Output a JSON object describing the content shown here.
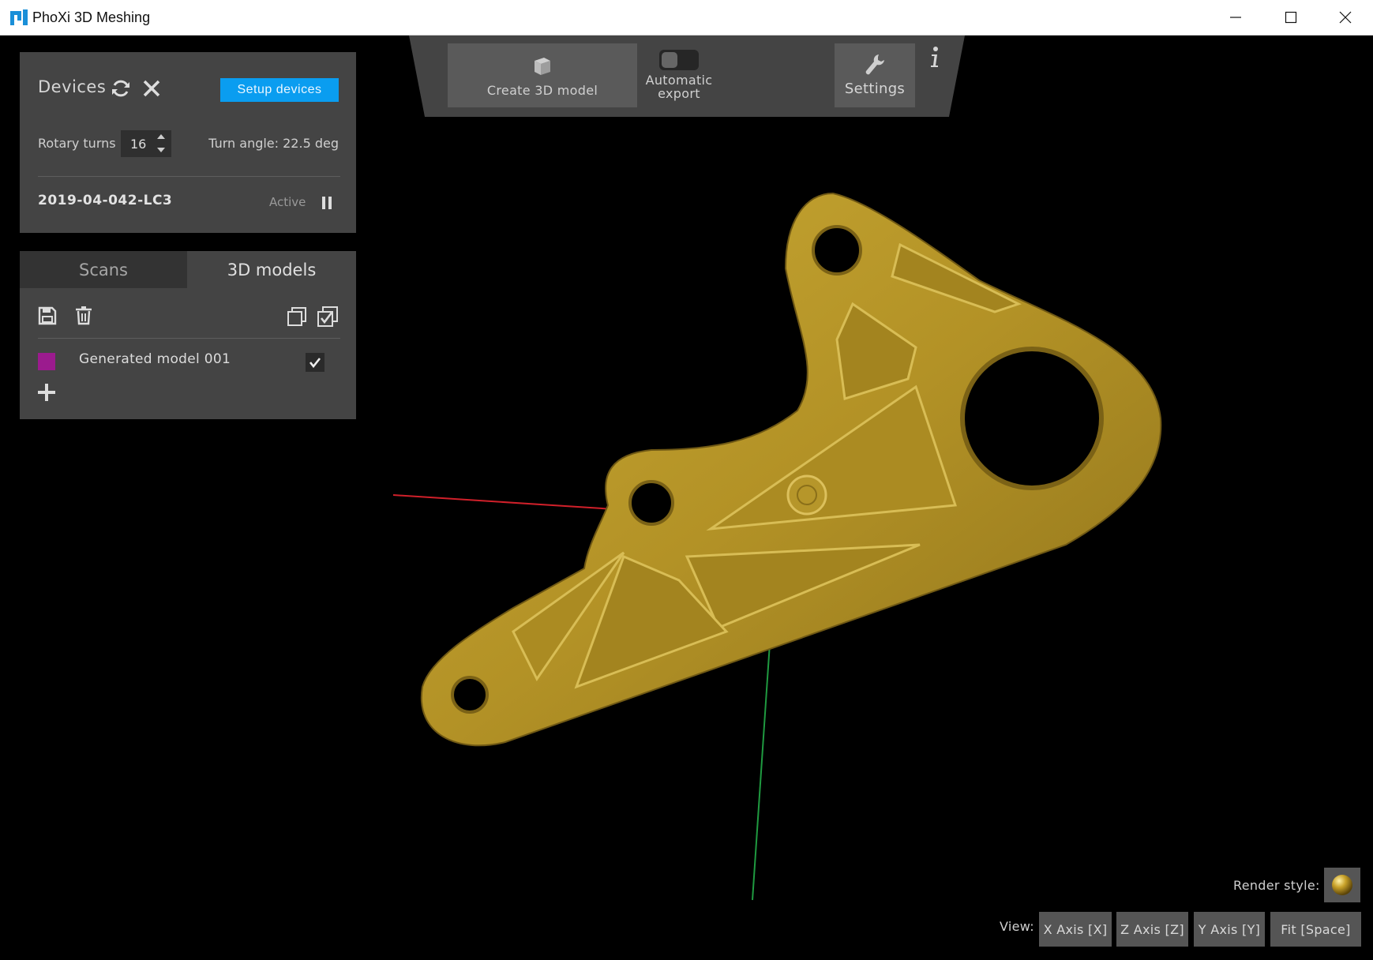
{
  "window": {
    "title": "PhoXi 3D Meshing",
    "logo_color": "#1a8fd8"
  },
  "devices": {
    "title": "Devices",
    "setup_button": "Setup devices",
    "rotary_label": "Rotary turns",
    "rotary_value": "16",
    "turn_angle": "Turn angle: 22.5 deg",
    "device_name": "2019-04-042-LC3",
    "device_status": "Active"
  },
  "models_panel": {
    "tabs": [
      {
        "label": "Scans",
        "active": false
      },
      {
        "label": "3D models",
        "active": true
      }
    ],
    "models": [
      {
        "name": "Generated model 001",
        "color": "#9b1b8e",
        "visible": true
      }
    ]
  },
  "toolbar": {
    "create_label": "Create 3D model",
    "auto_export_line1": "Automatic",
    "auto_export_line2": "export",
    "auto_export_on": false,
    "settings_label": "Settings"
  },
  "bottom": {
    "render_label": "Render style:",
    "view_label": "View:",
    "view_buttons": [
      "X Axis [X]",
      "Z Axis [Z]",
      "Y Axis [Y]",
      "Fit [Space]"
    ]
  },
  "colors": {
    "accent": "#0a9df0",
    "panel": "#444444",
    "model": "#b89a25",
    "axis_x": "#d0202a",
    "axis_y": "#1f9a40",
    "axis_z": "#1a7fcf"
  }
}
